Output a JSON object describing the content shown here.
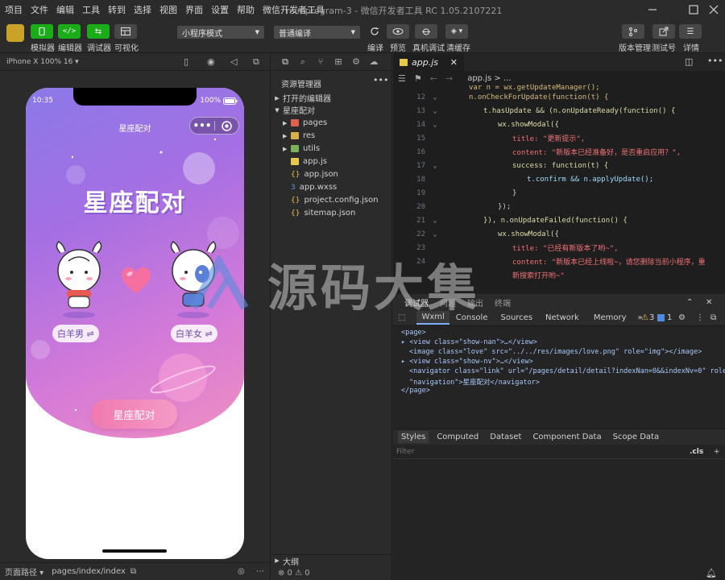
{
  "menubar": {
    "items": [
      "项目",
      "文件",
      "编辑",
      "工具",
      "转到",
      "选择",
      "视图",
      "界面",
      "设置",
      "帮助",
      "微信开发者工具"
    ],
    "title": "miniprogram-3 - 微信开发者工具 RC 1.05.2107221"
  },
  "toolbar": {
    "simulator": "模拟器",
    "editor": "编辑器",
    "debugger": "调试器",
    "visual": "可视化",
    "mode_select": "小程序模式",
    "compile_select": "普通编译",
    "compile": "编译",
    "preview": "预览",
    "remote_debug": "真机调试",
    "clear_cache": "清缓存",
    "version_mgmt": "版本管理",
    "test_account": "测试号",
    "details": "详情",
    "accent_green": "#1aad19"
  },
  "simulator": {
    "device": "iPhone X 100% 16 ▾",
    "status_time": "10:35",
    "status_batt": "100%",
    "nav_title": "星座配对",
    "hero_title": "星座配对",
    "left_label": "白羊男 ⇌",
    "right_label": "白羊女 ⇌",
    "cta": "星座配对",
    "footer_path_label": "页面路径 ▾",
    "footer_path": "pages/index/index"
  },
  "explorer": {
    "header": "资源管理器",
    "open_editors": "打开的编辑器",
    "project": "星座配对",
    "items": [
      {
        "name": "pages",
        "type": "folder-red"
      },
      {
        "name": "res",
        "type": "folder"
      },
      {
        "name": "utils",
        "type": "folder-green"
      },
      {
        "name": "app.js",
        "type": "js"
      },
      {
        "name": "app.json",
        "type": "json"
      },
      {
        "name": "app.wxss",
        "type": "wxss"
      },
      {
        "name": "project.config.json",
        "type": "json"
      },
      {
        "name": "sitemap.json",
        "type": "json"
      }
    ],
    "outline": "大纲",
    "problems": "⊗ 0 ⚠ 0"
  },
  "editor": {
    "tab": "app.js",
    "breadcrumb": "app.js > ...",
    "lines": [
      {
        "n": "",
        "t": "var n = wx.getUpdateManager();"
      },
      {
        "n": "12",
        "t": "n.onCheckForUpdate(function(t) {"
      },
      {
        "n": "13",
        "t": "t.hasUpdate && (n.onUpdateReady(function() {"
      },
      {
        "n": "14",
        "t": "wx.showModal({"
      },
      {
        "n": "15",
        "t": "title: \"更新提示\","
      },
      {
        "n": "16",
        "t": "content: \"新版本已经准备好，是否重启应用？\","
      },
      {
        "n": "17",
        "t": "success: function(t) {"
      },
      {
        "n": "18",
        "t": "t.confirm && n.applyUpdate();"
      },
      {
        "n": "19",
        "t": "}"
      },
      {
        "n": "20",
        "t": "});"
      },
      {
        "n": "21",
        "t": "}), n.onUpdateFailed(function() {"
      },
      {
        "n": "22",
        "t": "wx.showModal({"
      },
      {
        "n": "23",
        "t": "title: \"已经有新版本了哟~\","
      },
      {
        "n": "24",
        "t": "content: \"新版本已经上线啦~，请您删除当前小程序，重"
      },
      {
        "n": "",
        "t": "新搜索打开哟~\""
      }
    ]
  },
  "devtools": {
    "top_tabs": [
      "调试器",
      "问题",
      "输出",
      "终端"
    ],
    "tabs": [
      "Wxml",
      "Console",
      "Sources",
      "Network",
      "Memory",
      "»"
    ],
    "warn_count": "3",
    "info_count": "1",
    "wxml": [
      "<page>",
      "▸ <view class=\"show-nan\">…</view>",
      "<image class=\"love\" src=\"../../res/images/love.png\" role=\"img\"></image>",
      "▸ <view class=\"show-nv\">…</view>",
      "<navigator class=\"link\" url=\"/pages/detail/detail?indexNan=0&&indexNv=0\" role=",
      "\"navigation\">星座配对</navigator>",
      "</page>"
    ],
    "style_tabs": [
      "Styles",
      "Computed",
      "Dataset",
      "Component Data",
      "Scope Data"
    ],
    "filter_placeholder": "Filter",
    "cls": ".cls"
  },
  "watermark": "源码大集"
}
